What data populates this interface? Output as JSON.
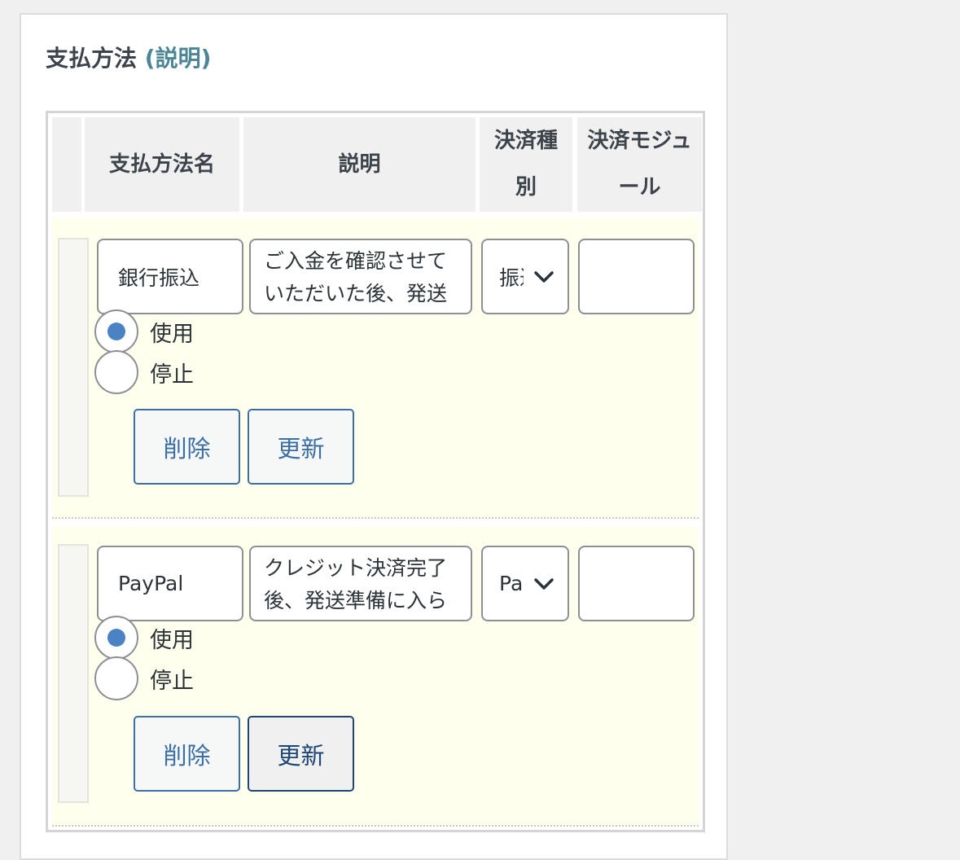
{
  "section": {
    "title": "支払方法",
    "help_link": "(説明)"
  },
  "table": {
    "headers": {
      "name": "支払方法名",
      "description": "説明",
      "payment_type_line1": "決済種",
      "payment_type_line2": "別",
      "module_line1": "決済モジュ",
      "module_line2": "ール"
    },
    "rows": [
      {
        "name": "銀行振込",
        "description_line1": "ご入金を確認させて",
        "description_line2": "いただいた後、発送",
        "payment_type": "振込",
        "module": "",
        "status_use": "使用",
        "status_stop": "停止",
        "status_selected": "使用",
        "delete_label": "削除",
        "update_label": "更新"
      },
      {
        "name": "PayPal",
        "description_line1": "クレジット決済完了",
        "description_line2": "後、発送準備に入ら",
        "payment_type": "PayPal",
        "module": "",
        "status_use": "使用",
        "status_stop": "停止",
        "status_selected": "使用",
        "delete_label": "削除",
        "update_label": "更新"
      }
    ]
  },
  "icons": {
    "select_arrow": "chevron-down-icon"
  },
  "colors": {
    "link": "#4b8596",
    "button": "#3b6ea5",
    "row_background": "#ffffee",
    "radio_checked": "#4a82c4"
  }
}
